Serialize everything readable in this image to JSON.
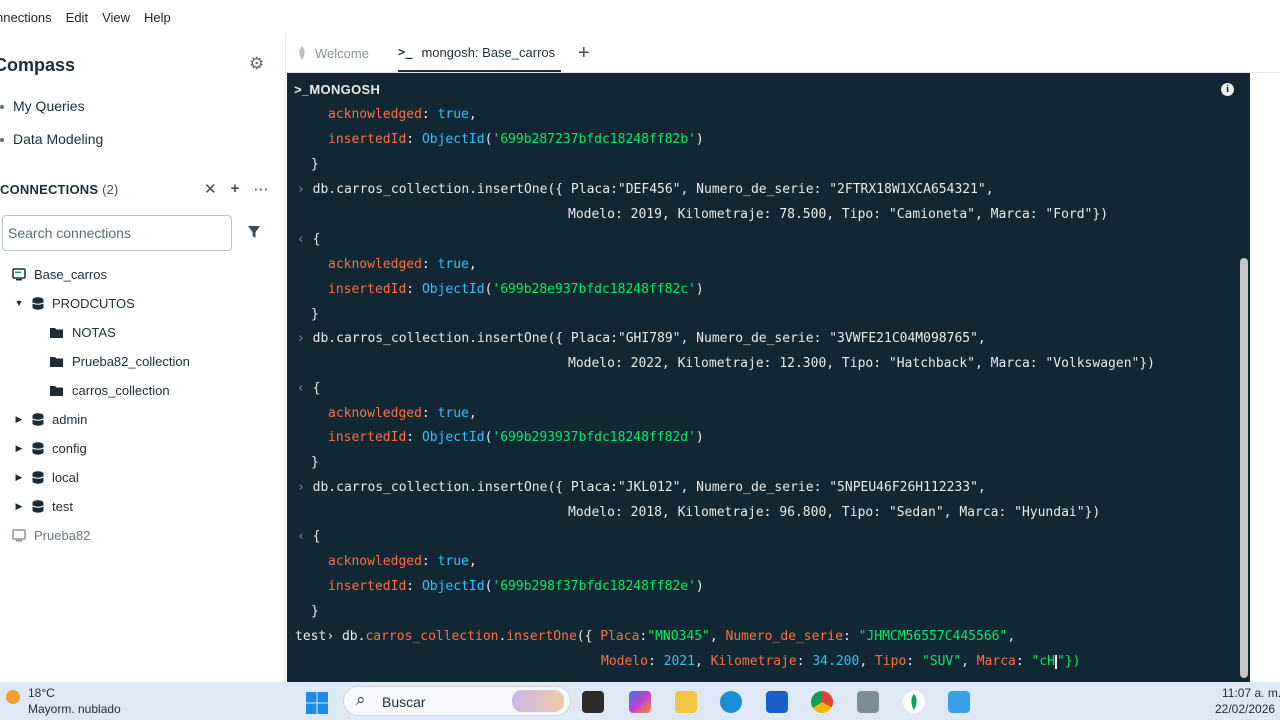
{
  "menu": [
    "nnections",
    "Edit",
    "View",
    "Help"
  ],
  "sidebar": {
    "title": "Compass",
    "nav": [
      "My Queries",
      "Data Modeling"
    ],
    "connections_label": "CONNECTIONS",
    "connections_count": "(2)",
    "search_placeholder": "Search connections",
    "tree": [
      {
        "label": "Base_carros"
      },
      {
        "label": "PRODCUTOS"
      },
      {
        "label": "NOTAS"
      },
      {
        "label": "Prueba82_collection"
      },
      {
        "label": "carros_collection"
      },
      {
        "label": "admin"
      },
      {
        "label": "config"
      },
      {
        "label": "local"
      },
      {
        "label": "test"
      },
      {
        "label": "Prueba82"
      }
    ]
  },
  "tabs": {
    "welcome": "Welcome",
    "active": "mongosh: Base_carros",
    "add": "+"
  },
  "shell": {
    "header": ">_MONGOSH",
    "prompt": "test",
    "lines": {
      "l1_key": "acknowledged",
      "l1_val": "true",
      "l2_key": "insertedId",
      "l2_fn": "ObjectId",
      "l2_id": "'699b287237bfdc18248ff82b'",
      "cmd2a": "db.carros_collection.insertOne({ Placa:\"DEF456\", Numero_de_serie: \"2FTRX18W1XCA654321\",",
      "cmd2b": "Modelo: 2019, Kilometraje: 78.500, Tipo: \"Camioneta\", Marca: \"Ford\"})",
      "id2": "'699b28e937bfdc18248ff82c'",
      "cmd3a": "db.carros_collection.insertOne({ Placa:\"GHI789\", Numero_de_serie: \"3VWFE21C04M098765\",",
      "cmd3b": "Modelo: 2022, Kilometraje: 12.300, Tipo: \"Hatchback\", Marca: \"Volkswagen\"})",
      "id3": "'699b293937bfdc18248ff82d'",
      "cmd4a": "db.carros_collection.insertOne({ Placa:\"JKL012\", Numero_de_serie: \"5NPEU46F26H112233\",",
      "cmd4b": "Modelo: 2018, Kilometraje: 96.800, Tipo: \"Sedan\", Marca: \"Hyundai\"})",
      "id4": "'699b298f37bfdc18248ff82e'",
      "cur_a_db": "db",
      "cur_a_coll": "carros_collection",
      "cur_a_fn": "insertOne",
      "cur_a_rest1": "Placa",
      "cur_a_v1": "\"MNO345\"",
      "cur_a_k2": "Numero_de_serie",
      "cur_a_v2": "\"JHMCM56557C445566\"",
      "cur_b_k1": "Modelo",
      "cur_b_v1": "2021",
      "cur_b_k2": "Kilometraje",
      "cur_b_v2": "34.200",
      "cur_b_k3": "Tipo",
      "cur_b_v3": "\"SUV\"",
      "cur_b_k4": "Marca",
      "cur_b_v4": "\"cH",
      "cur_b_end": "\"})"
    }
  },
  "taskbar": {
    "weather_temp": "18°C",
    "weather_desc": "Mayorm. nublado",
    "search": "Buscar",
    "time": "11:07 a. m.",
    "date": "22/02/2026"
  },
  "colors": {
    "shell_bg": "#112733",
    "key": "#ff6f44",
    "string": "#00ed64",
    "number": "#2dc4ff"
  }
}
